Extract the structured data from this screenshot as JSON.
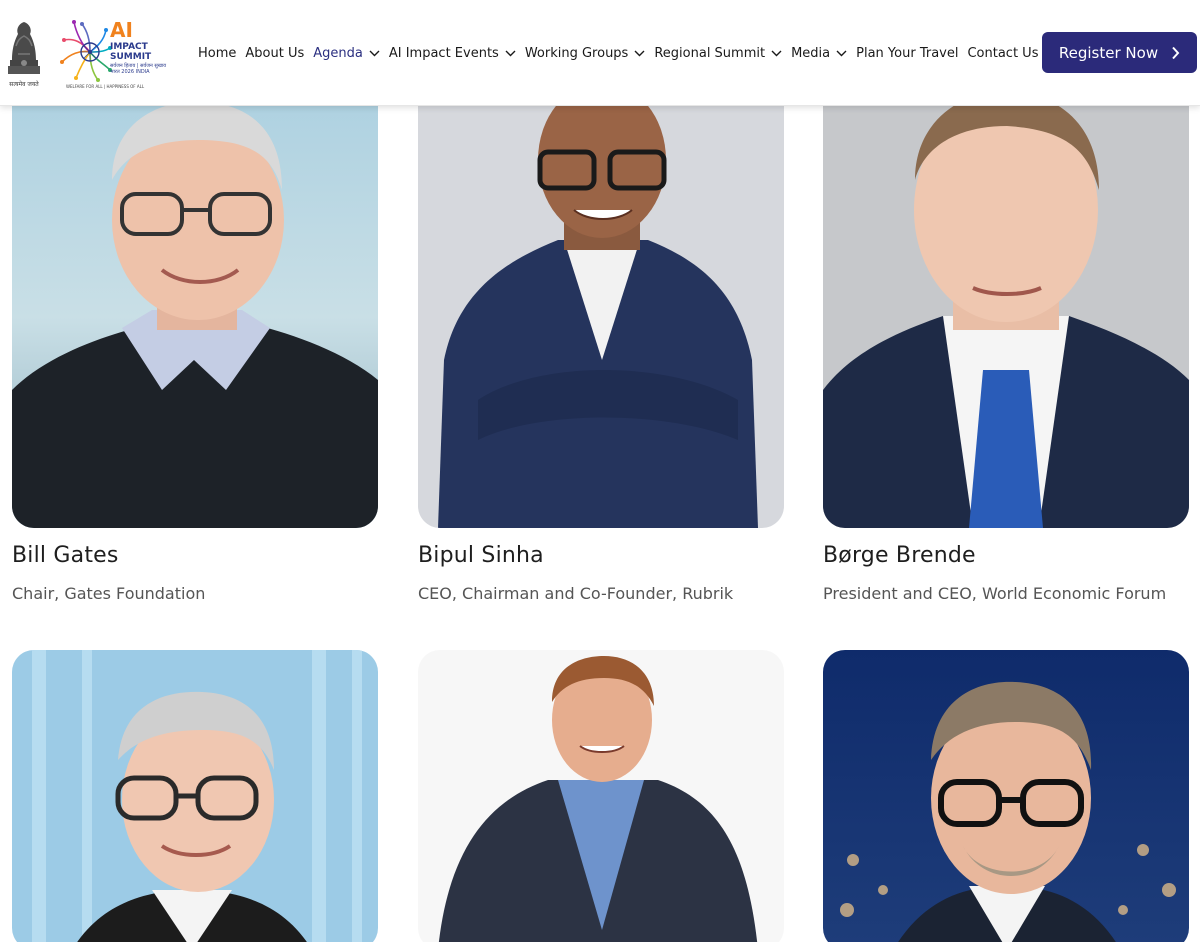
{
  "header": {
    "emblem_caption": "सत्यमेव जयते",
    "logo": {
      "ai": "AI",
      "impact": "IMPACT",
      "summit": "SUMMIT",
      "tagline": "सर्वजन हिताय | सर्वजन सुखाय",
      "country": "भारत 2026 INDIA",
      "footer": "WELFARE FOR ALL | HAPPINESS OF ALL"
    },
    "nav": [
      {
        "label": "Home",
        "dropdown": false,
        "active": false
      },
      {
        "label": "About Us",
        "dropdown": false,
        "active": false
      },
      {
        "label": "Agenda",
        "dropdown": true,
        "active": true
      },
      {
        "label": "AI Impact Events",
        "dropdown": true,
        "active": false
      },
      {
        "label": "Working Groups",
        "dropdown": true,
        "active": false
      },
      {
        "label": "Regional Summit",
        "dropdown": true,
        "active": false
      },
      {
        "label": "Media",
        "dropdown": true,
        "active": false
      },
      {
        "label": "Plan Your Travel",
        "dropdown": false,
        "active": false
      },
      {
        "label": "Contact Us",
        "dropdown": false,
        "active": false
      }
    ],
    "register_label": "Register Now",
    "register_icon": "chevron-right-icon",
    "dropdown_icon": "chevron-down-icon"
  },
  "colors": {
    "brand": "#2b2a7a",
    "logo_orange": "#f0821e",
    "text": "#1e1e1e",
    "muted": "#555555"
  },
  "speakers": [
    {
      "name": "Bill Gates",
      "role": "Chair, Gates Foundation",
      "photo": "portrait-photo"
    },
    {
      "name": "Bipul Sinha",
      "role": "CEO, Chairman and Co-Founder, Rubrik",
      "photo": "portrait-photo"
    },
    {
      "name": "Børge Brende",
      "role": "President and CEO, World Economic Forum",
      "photo": "portrait-photo"
    },
    {
      "name": "",
      "role": "",
      "photo": "portrait-photo"
    },
    {
      "name": "",
      "role": "",
      "photo": "portrait-photo"
    },
    {
      "name": "",
      "role": "",
      "photo": "portrait-photo"
    }
  ]
}
